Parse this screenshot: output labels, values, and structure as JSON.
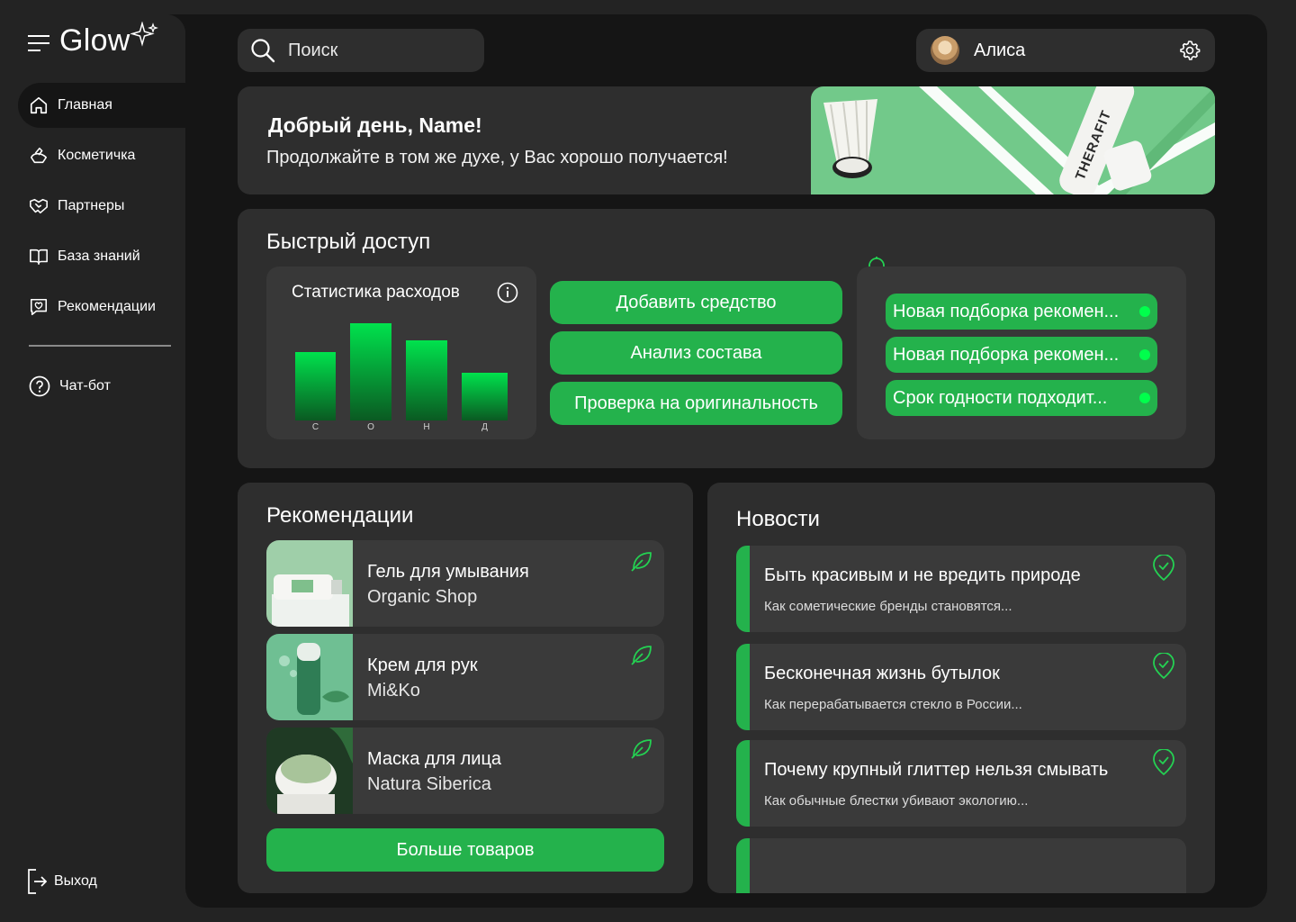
{
  "app": {
    "name": "Glow"
  },
  "sidebar": {
    "items": [
      {
        "label": "Главная",
        "icon": "home-icon",
        "active": true
      },
      {
        "label": "Косметичка",
        "icon": "cosmetic-bag-icon"
      },
      {
        "label": "Партнеры",
        "icon": "handshake-icon"
      },
      {
        "label": "База знаний",
        "icon": "book-icon"
      },
      {
        "label": "Рекомендации",
        "icon": "heart-chat-icon"
      },
      {
        "label": "Чат-бот",
        "icon": "help-circle-icon"
      }
    ],
    "logout_label": "Выход"
  },
  "header": {
    "search_placeholder": "Поиск",
    "user_name": "Алиса"
  },
  "greeting": {
    "title": "Добрый день, Name!",
    "subtitle": "Продолжайте в том же духе, у Вас хорошо получается!",
    "banner_brand": "THERAFIT"
  },
  "quick_access": {
    "title": "Быстрый доступ",
    "actions": [
      "Добавить средство",
      "Анализ состава",
      "Проверка на оригинальность"
    ],
    "notifications": [
      "Новая подборка рекомен...",
      "Новая подборка рекомен...",
      "Срок годности подходит..."
    ]
  },
  "chart_data": {
    "type": "bar",
    "title": "Статистика расходов",
    "categories": [
      "С",
      "О",
      "Н",
      "Д"
    ],
    "values": [
      0.7,
      1.0,
      0.82,
      0.49
    ],
    "ylim": [
      0,
      1
    ],
    "grid": false
  },
  "recommendations": {
    "title": "Рекомендации",
    "items": [
      {
        "name": "Гель для умывания",
        "brand": "Organic Shop"
      },
      {
        "name": "Крем для рук",
        "brand": "Mi&Ko"
      },
      {
        "name": "Маска для лица",
        "brand": "Natura Siberica"
      }
    ],
    "more_label": "Больше товаров"
  },
  "news": {
    "title": "Новости",
    "items": [
      {
        "title": "Быть красивым и не вредить природе",
        "subtitle": "Как сометические бренды становятся..."
      },
      {
        "title": "Бесконечная жизнь бутылок",
        "subtitle": "Как перерабатывается стекло в России..."
      },
      {
        "title": "Почему крупный глиттер нельзя смывать",
        "subtitle": "Как обычные блестки убивают экологию..."
      }
    ]
  },
  "colors": {
    "accent": "#24b24c",
    "panel": "#151515",
    "card": "#2e2e2e",
    "background": "#232323"
  }
}
